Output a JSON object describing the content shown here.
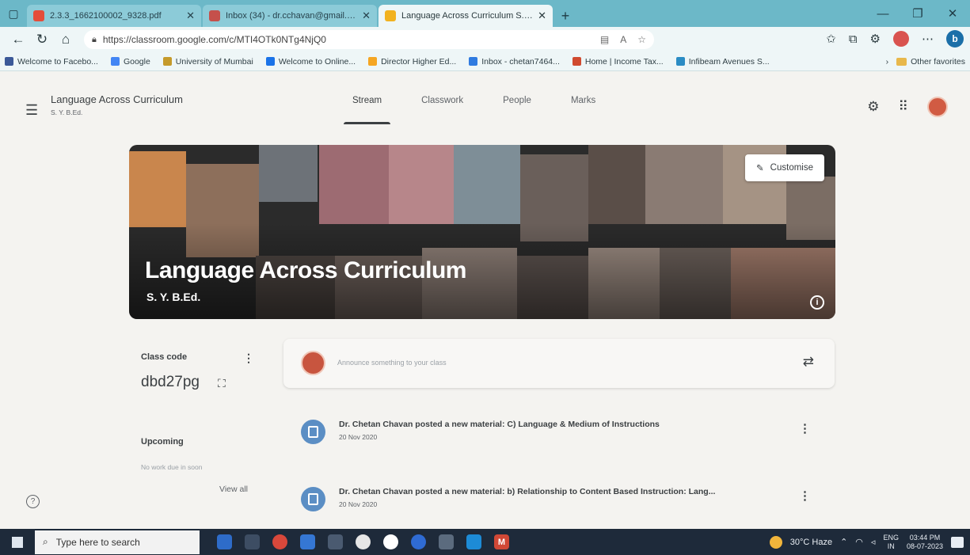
{
  "browser": {
    "tabs": [
      {
        "label": "2.3.3_1662100002_9328.pdf",
        "color": "#e44d3a"
      },
      {
        "label": "Inbox (34) - dr.cchavan@gmail.com",
        "color": "#c5504b"
      },
      {
        "label": "Language Across Curriculum S. Y. B.Ed.",
        "color": "#f2b21f"
      }
    ],
    "new_tab": "+",
    "url": "https://classroom.google.com/c/MTI4OTk0NTg4NjQ0",
    "bookmarks": [
      {
        "label": "Welcome to Facebo...",
        "color": "#3b5998"
      },
      {
        "label": "Google",
        "color": "#4285f4"
      },
      {
        "label": "University of Mumbai",
        "color": "#c59a2b"
      },
      {
        "label": "Welcome to Online...",
        "color": "#1a73e8"
      },
      {
        "label": "Director Higher Ed...",
        "color": "#f5a623"
      },
      {
        "label": "Inbox - chetan7464...",
        "color": "#2f7be0"
      },
      {
        "label": "Home | Income Tax...",
        "color": "#d04a2f"
      },
      {
        "label": "Infibeam Avenues S...",
        "color": "#2b8cc4"
      }
    ],
    "other_favorites": "Other favorites",
    "more_bookmarks": "›"
  },
  "classroom": {
    "class_title": "Language Across Curriculum",
    "class_section": "S. Y. B.Ed.",
    "nav_tabs": [
      "Stream",
      "Classwork",
      "People",
      "Marks"
    ],
    "active_tab": "Stream",
    "banner": {
      "title": "Language Across Curriculum",
      "subtitle": "S. Y. B.Ed.",
      "customise_label": "Customise",
      "info_glyph": "i"
    },
    "class_code": {
      "label": "Class code",
      "value": "dbd27pg"
    },
    "upcoming": {
      "label": "Upcoming",
      "empty_text": "No work due in soon",
      "view_all": "View all"
    },
    "announce_placeholder": "Announce something to your class",
    "posts": [
      {
        "title": "Dr. Chetan Chavan posted a new material: C) Language & Medium of Instructions",
        "date": "20 Nov 2020"
      },
      {
        "title": "Dr. Chetan Chavan posted a new material: b) Relationship to Content Based Instruction: Lang...",
        "date": "20 Nov 2020"
      }
    ]
  },
  "taskbar": {
    "search_placeholder": "Type here to search",
    "weather": "30°C Haze",
    "lang_top": "ENG",
    "lang_bottom": "IN",
    "time": "03:44 PM",
    "date": "08-07-2023"
  },
  "colors": {
    "accent_tab_bar": "#6cb8c8",
    "avatar": "#d15b43",
    "material_icon": "#5b8ec4"
  }
}
